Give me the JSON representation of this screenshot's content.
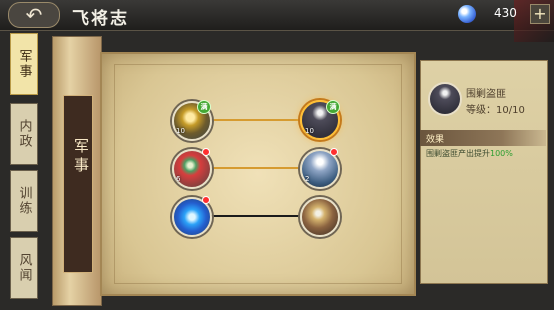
{
  "header": {
    "back_label": "↶",
    "title": "飞将志",
    "currency_value": "430",
    "plus_label": "+"
  },
  "sidebar": {
    "tabs": [
      {
        "label": "军事",
        "active": true
      },
      {
        "label": "内政",
        "active": false
      },
      {
        "label": "训练",
        "active": false
      },
      {
        "label": "风闻",
        "active": false
      }
    ]
  },
  "scroll": {
    "label": "军事"
  },
  "map": {
    "nodes": [
      {
        "count": "10",
        "badge": "满"
      },
      {
        "count": "10",
        "badge": "满"
      },
      {
        "count": "6",
        "badge": ""
      },
      {
        "count": "2",
        "badge": ""
      },
      {
        "count": "",
        "badge": ""
      },
      {
        "count": "",
        "badge": ""
      }
    ]
  },
  "detail": {
    "name": "围剿盗匪",
    "level": "等级：10/10",
    "effect_title": "效果",
    "effect_text": "围剿盗匪产出提升",
    "effect_value": "100%"
  }
}
